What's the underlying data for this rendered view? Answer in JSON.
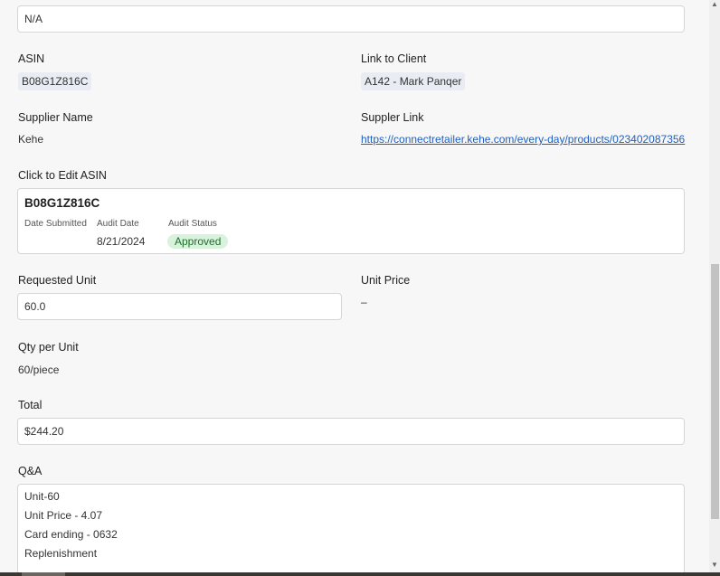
{
  "top_field": {
    "value": "N/A"
  },
  "asin": {
    "label": "ASIN",
    "value": "B08G1Z816C"
  },
  "link_to_client": {
    "label": "Link to Client",
    "value": "A142 - Mark Panqer"
  },
  "supplier_name": {
    "label": "Supplier Name",
    "value": "Kehe"
  },
  "supplier_link": {
    "label": "Suppler Link",
    "value": "https://connectretailer.kehe.com/every-day/products/023402087356"
  },
  "edit_asin": {
    "label": "Click to Edit ASIN",
    "title": "B08G1Z816C",
    "date_submitted_label": "Date Submitted",
    "audit_date_label": "Audit Date",
    "audit_date_value": "8/21/2024",
    "audit_status_label": "Audit Status",
    "audit_status_value": "Approved",
    "status_color": "#d9f2dc"
  },
  "requested_unit": {
    "label": "Requested Unit",
    "value": "60.0"
  },
  "unit_price": {
    "label": "Unit Price",
    "value": "–"
  },
  "qty_per_unit": {
    "label": "Qty per Unit",
    "value": "60/piece"
  },
  "total": {
    "label": "Total",
    "value": "$244.20"
  },
  "qa": {
    "label": "Q&A",
    "lines": [
      "Unit-60",
      "Unit Price - 4.07",
      "Card ending - 0632",
      "Replenishment"
    ]
  },
  "scrollbar": {
    "up_icon": "chevron-up-icon",
    "down_icon": "chevron-down-icon"
  }
}
